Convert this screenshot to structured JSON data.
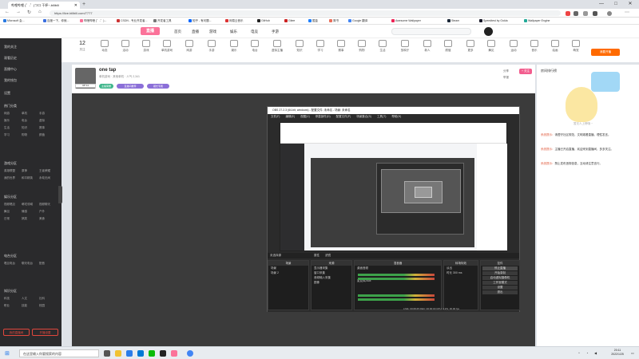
{
  "browser": {
    "tab_title": "哔哩哔哩 (゜-゜)つロ 干杯~-bilibili",
    "new_tab": "+",
    "url": "https://live.bilibili.com/7777",
    "window_controls": [
      "—",
      "□",
      "✕"
    ],
    "bookmarks": [
      "Microsoft 会...",
      "百度一下，你就...",
      "哔哩哔哩 (゜-゜)...",
      "CSDN - 专业开发者...",
      "开发者工具",
      "知乎 - 有问题...",
      "网易云音乐",
      "GitHub",
      "Gitee",
      "掘金",
      "简书",
      "Google 翻译",
      "Awesome Wallpaper",
      "Steam",
      "Speedtest by Ookla",
      "Wallpaper Engine"
    ]
  },
  "site": {
    "logo_text": "直播",
    "nav": [
      "首页",
      "直播",
      "游戏",
      "娱乐",
      "电竞",
      "手游"
    ],
    "room_count": "12",
    "room_count_label": "关注",
    "categories": [
      "动态",
      "活动",
      "游戏",
      "单机游戏",
      "网游",
      "手游",
      "娱乐",
      "电台",
      "虚拟主播",
      "知识",
      "学习",
      "赛事",
      "购物",
      "生活",
      "放映厅",
      "新人",
      "颜值",
      "更多",
      "舞见",
      "运动",
      "音乐",
      "绘画",
      "萌宠"
    ],
    "open_live_button": "我要开播"
  },
  "left_panel": {
    "items": [
      "我的关注",
      "观看历史",
      "直播中心",
      "我的钱包",
      "设置"
    ],
    "sections": [
      {
        "title": "热门分类",
        "cells": [
          "网游",
          "单机",
          "手游",
          "娱乐",
          "电台",
          "虚拟",
          "生活",
          "知识",
          "赛事",
          "学习",
          "购物",
          "颜值"
        ]
      },
      {
        "title": "游戏分区",
        "cells": [
          "英雄联盟",
          "原神",
          "王者荣耀",
          "我的世界",
          "和平精英",
          "永劫无间"
        ]
      },
      {
        "title": "娱乐分区",
        "cells": [
          "视频唱见",
          "萌宅领域",
          "视频聊天",
          "舞见",
          "情感",
          "户外",
          "日常",
          "搞笑",
          "美食"
        ]
      },
      {
        "title": "电台分区",
        "cells": [
          "唱见电台",
          "聊天电台",
          "配音"
        ]
      },
      {
        "title": "知识分区",
        "cells": [
          "科技",
          "人文",
          "社科",
          "职业",
          "技能",
          "校园"
        ]
      }
    ],
    "buttons": [
      "我的直播间",
      "开播设置"
    ]
  },
  "room": {
    "title": "one tap",
    "meta": "单机游戏 · 其他单机 · 人气 2,341",
    "level_badge": "UP 11",
    "tags": [
      "主播荣耀",
      "直播间推荐",
      "舰长专属"
    ],
    "right_stats": [
      "分享",
      "举报"
    ],
    "follow_label": "+ 关注"
  },
  "obs": {
    "title": "OBS 27.2.3 (64-bit, windows) - 配置文件: 未命名 - 场景: 未命名",
    "menu": [
      "文件(F)",
      "编辑(E)",
      "视图(V)",
      "停靠部件(D)",
      "配置文件(P)",
      "场景集合(S)",
      "工具(T)",
      "帮助(H)"
    ],
    "tabline": [
      "未选择源",
      "属性",
      "滤镜"
    ],
    "docks": {
      "scenes": {
        "header": "场景",
        "rows": [
          "场景",
          "场景 2"
        ]
      },
      "sources": {
        "header": "来源",
        "rows": [
          "显示器采集",
          "窗口采集",
          "音频输入采集",
          "图像"
        ]
      },
      "mixer": {
        "header": "混音器",
        "tracks": [
          "桌面音频",
          "麦克风/Aux"
        ]
      },
      "transitions": {
        "header": "转场特效",
        "rows": [
          "淡出",
          "时长 300 ms"
        ]
      },
      "controls": {
        "header": "控件",
        "buttons": [
          "停止直播",
          "开始录制",
          "启动虚拟摄像机",
          "工作室模式",
          "设置",
          "退出"
        ]
      }
    },
    "status": "LIVE: 00:08:25  REC: 00:00:00  CPU: 4.2%, 30.00 fps"
  },
  "right_sidebar": {
    "header": "房间排行榜",
    "mascot_caption": "暂无人上榜哦 ~",
    "messages": [
      {
        "user": "系统提示：",
        "text": "请遵守社区规范，文明观看直播，理性发言。"
      },
      {
        "user": "系统提示：",
        "text": "主播已开启直播，欢迎来到直播间，多多关注。"
      },
      {
        "user": "系统提示：",
        "text": "禁止发布违规信息，互动请注意言行。"
      }
    ]
  },
  "taskbar": {
    "search_placeholder": "在这里输入你要搜索的内容",
    "time": "20:11",
    "date": "2022/1/25"
  },
  "colors": {
    "brand": "#fb7299",
    "accent": "#ff6a00",
    "dark_panel": "#2a2a2c"
  }
}
